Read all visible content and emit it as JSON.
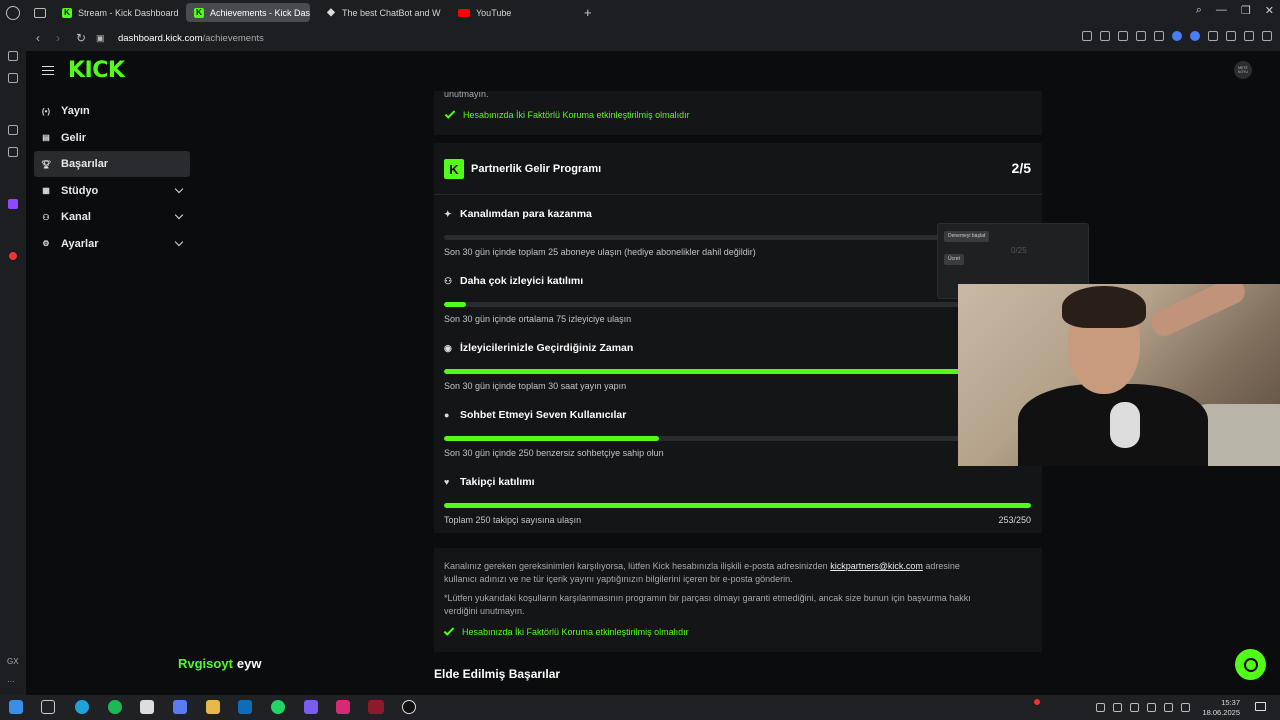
{
  "browser": {
    "tabs": [
      {
        "label": "Stream - Kick Dashboard",
        "favicon": "kick",
        "active": false
      },
      {
        "label": "Achievements - Kick Das",
        "favicon": "kick",
        "active": true
      },
      {
        "label": "The best ChatBot and W",
        "favicon": "chatbot",
        "active": false
      },
      {
        "label": "YouTube",
        "favicon": "youtube",
        "active": false
      }
    ],
    "url_host": "dashboard.kick.com",
    "url_path": "/achievements"
  },
  "kick": {
    "logo": "KICK",
    "avatar_text": "METE KOYU"
  },
  "sidebar": {
    "items": [
      {
        "label": "Yayın",
        "icon": "broadcast-icon"
      },
      {
        "label": "Gelir",
        "icon": "wallet-icon"
      },
      {
        "label": "Başarılar",
        "icon": "trophy-icon",
        "active": true
      },
      {
        "label": "Stüdyo",
        "icon": "studio-icon",
        "expandable": true
      },
      {
        "label": "Kanal",
        "icon": "channel-icon",
        "expandable": true
      },
      {
        "label": "Ayarlar",
        "icon": "gear-icon",
        "expandable": true
      }
    ]
  },
  "main": {
    "top_card": {
      "trailing_text": "unutmayın.",
      "twofa": "Hesabınızda İki Faktörlü Koruma etkinleştirilmiş olmalıdır"
    },
    "program": {
      "logo": "K",
      "title": "Partnerlik Gelir Programı",
      "count": "2/5",
      "achievements": [
        {
          "title": "Kanalımdan para kazanma",
          "icon": "✦",
          "desc": "Son 30 gün içinde toplam 25 aboneye ulaşın (hediye abonelikler dahil değildir)",
          "value": "0/25",
          "progress": 0.0
        },
        {
          "title": "Daha çok izleyici katılımı",
          "icon": "⚇",
          "desc": "Son 30 gün içinde ortalama 75 izleyiciye ulaşın",
          "value": "",
          "progress": 0.037
        },
        {
          "title": "İzleyicilerinizle Geçirdiğiniz Zaman",
          "icon": "((•))",
          "desc": "Son 30 gün içinde toplam 30 saat yayın yapın",
          "value": "",
          "progress": 1.0
        },
        {
          "title": "Sohbet Etmeyi Seven Kullanıcılar",
          "icon": "●",
          "desc": "Son 30 gün içinde 250 benzersiz sohbetçiye sahip olun",
          "value": "",
          "progress": 0.366
        },
        {
          "title": "Takipçi katılımı",
          "icon": "♥",
          "desc": "Toplam 250 takipçi sayısına ulaşın",
          "value": "253/250",
          "progress": 1.0
        }
      ]
    },
    "info_card": {
      "line1_pre": "Kanalınız gereken gereksinimleri karşılıyorsa, lütfen Kick hesabınızla ilişkili e-posta adresinizden",
      "email": "kickpartners@kick.com",
      "line1_post": "adresine",
      "line2": "kullanıcı adınızı ve ne tür içerik yayını yaptığınızın bilgilerini içeren bir e-posta gönderin.",
      "line3": "*Lütfen yukarıdaki koşulların karşılanmasının programın bir parçası olmayı garanti etmediğini, ancak size bunun için başvurma hakkı",
      "line4": "verdiğini unutmayın.",
      "twofa": "Hesabınızda İki Faktörlü Koruma etkinleştirilmiş olmalıdır"
    },
    "earned_heading": "Elde Edilmiş Başarılar"
  },
  "popup": {
    "btn1": "Denemeyi başlat",
    "btn2": "Ücret"
  },
  "chat_overlay": {
    "user": "Rvgisoyt",
    "message": "eyw"
  },
  "taskbar": {
    "time": "15:37",
    "date": "18.06.2025"
  },
  "colors": {
    "kick_green": "#53fc18",
    "bg": "#0b0c0e",
    "card": "#141517"
  }
}
